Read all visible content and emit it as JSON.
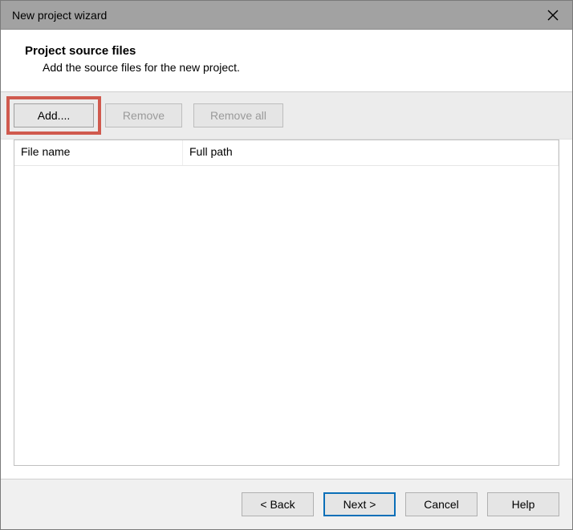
{
  "titlebar": {
    "title": "New project wizard"
  },
  "header": {
    "title": "Project source files",
    "subtitle": "Add the source files for the new project."
  },
  "toolbar": {
    "add_label": "Add....",
    "remove_label": "Remove",
    "remove_all_label": "Remove all"
  },
  "table": {
    "columns": {
      "filename": "File name",
      "fullpath": "Full path"
    },
    "rows": []
  },
  "footer": {
    "back_label": "< Back",
    "next_label": "Next >",
    "cancel_label": "Cancel",
    "help_label": "Help"
  },
  "colors": {
    "highlight": "#d05a4e",
    "primary_border": "#0a6fb8",
    "titlebar_bg": "#a2a2a2"
  }
}
